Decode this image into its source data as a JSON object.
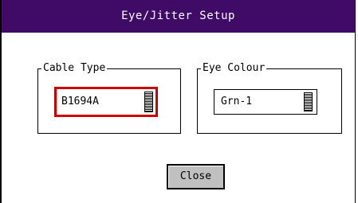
{
  "window": {
    "title": "Eye/Jitter Setup"
  },
  "groups": {
    "cable_type": {
      "label": "Cable Type",
      "value": "B1694A",
      "focused": true
    },
    "eye_colour": {
      "label": "Eye Colour",
      "value": "Grn-1",
      "focused": false
    }
  },
  "buttons": {
    "close_label": "Close"
  },
  "colors": {
    "titlebar": "#3f0b67",
    "focus_border": "#d00000",
    "button_face": "#c0c0c0"
  }
}
